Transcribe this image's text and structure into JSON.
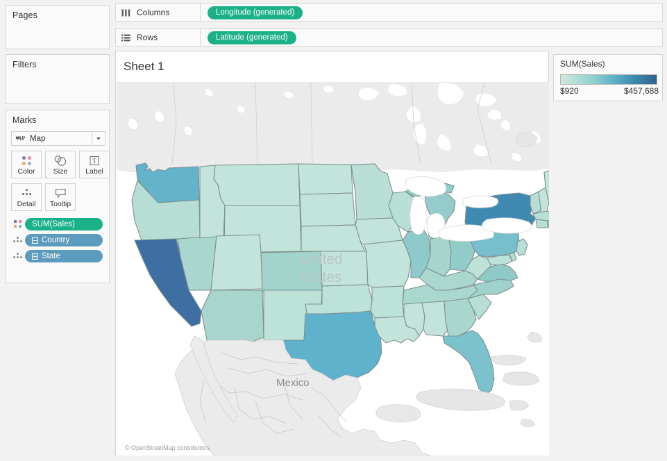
{
  "sidebar": {
    "pages": {
      "title": "Pages"
    },
    "filters": {
      "title": "Filters"
    },
    "marks": {
      "title": "Marks",
      "mark_type": "Map",
      "buttons": [
        {
          "label": "Color",
          "icon": "color-dots-icon"
        },
        {
          "label": "Size",
          "icon": "size-circles-icon"
        },
        {
          "label": "Label",
          "icon": "label-text-icon"
        },
        {
          "label": "Detail",
          "icon": "detail-dots-icon"
        },
        {
          "label": "Tooltip",
          "icon": "tooltip-bubble-icon"
        }
      ],
      "pills": [
        {
          "label": "SUM(Sales)",
          "type": "measure",
          "color": "#1ab188",
          "lead_icon": "color-dots-icon",
          "box": "none"
        },
        {
          "label": "Country",
          "type": "dimension",
          "color": "#5b9bbd",
          "lead_icon": "detail-dots-icon",
          "box": "minus"
        },
        {
          "label": "State",
          "type": "dimension",
          "color": "#5b9bbd",
          "lead_icon": "detail-dots-icon",
          "box": "plus"
        }
      ]
    }
  },
  "shelves": [
    {
      "name": "Columns",
      "icon": "columns-icon",
      "pill": "Longitude (generated)",
      "pill_color": "#1ab188"
    },
    {
      "name": "Rows",
      "icon": "rows-icon",
      "pill": "Latitude (generated)",
      "pill_color": "#1ab188"
    }
  ],
  "view": {
    "sheet_title": "Sheet 1",
    "attribution": "© OpenStreetMap contributors",
    "map_labels": {
      "united_states": "United States",
      "united_states_l1": "United",
      "united_states_l2": "States",
      "mexico": "Mexico"
    }
  },
  "legend": {
    "title": "SUM(Sales)",
    "min": "$920",
    "max": "$457,688",
    "gradient_start": "#cfeae0",
    "gradient_mid": "#5aaec8",
    "gradient_end": "#2e6490"
  },
  "chart_data": {
    "type": "map",
    "title": "Sheet 1",
    "measure": "SUM(Sales)",
    "value_min": 920,
    "value_max": 457688,
    "value_min_label": "$920",
    "value_max_label": "$457,688",
    "color_scale": [
      "#cfeae0",
      "#b3e0d8",
      "#8ed0d0",
      "#5aaec8",
      "#3b86ac",
      "#2e6490"
    ],
    "geography": "United States (states)",
    "states": [
      {
        "name": "California",
        "code": "CA",
        "bin": "very-high",
        "fill": "#3d6fa3"
      },
      {
        "name": "New York",
        "code": "NY",
        "bin": "very-high",
        "fill": "#3f8ab1"
      },
      {
        "name": "Texas",
        "code": "TX",
        "bin": "high",
        "fill": "#5eb2cb"
      },
      {
        "name": "Washington",
        "code": "WA",
        "bin": "high",
        "fill": "#63b3cb"
      },
      {
        "name": "Pennsylvania",
        "code": "PA",
        "bin": "med-high",
        "fill": "#77bfcd"
      },
      {
        "name": "Florida",
        "code": "FL",
        "bin": "med-high",
        "fill": "#7cc2cd"
      },
      {
        "name": "Illinois",
        "code": "IL",
        "bin": "med",
        "fill": "#8ecac9"
      },
      {
        "name": "Ohio",
        "code": "OH",
        "bin": "med",
        "fill": "#92ccc9"
      },
      {
        "name": "Michigan",
        "code": "MI",
        "bin": "med",
        "fill": "#93ccca"
      },
      {
        "name": "Virginia",
        "code": "VA",
        "bin": "med",
        "fill": "#8fcac9"
      },
      {
        "name": "North Carolina",
        "code": "NC",
        "bin": "med",
        "fill": "#9fd2cb"
      },
      {
        "name": "Arizona",
        "code": "AZ",
        "bin": "med-low",
        "fill": "#a8d6cd"
      },
      {
        "name": "Colorado",
        "code": "CO",
        "bin": "med-low",
        "fill": "#a3d4cc"
      },
      {
        "name": "Georgia",
        "code": "GA",
        "bin": "med-low",
        "fill": "#a9d7cd"
      },
      {
        "name": "Tennessee",
        "code": "TN",
        "bin": "med-low",
        "fill": "#aad8ce"
      },
      {
        "name": "Indiana",
        "code": "IN",
        "bin": "med-low",
        "fill": "#a5d5cd"
      },
      {
        "name": "Wisconsin",
        "code": "WI",
        "bin": "low",
        "fill": "#b7dfd5"
      },
      {
        "name": "Minnesota",
        "code": "MN",
        "bin": "low",
        "fill": "#badfd6"
      },
      {
        "name": "Oregon",
        "code": "OR",
        "bin": "low",
        "fill": "#b6ded4"
      },
      {
        "name": "Other states",
        "code": "--",
        "bin": "lowest",
        "fill": "#c2e4da"
      }
    ]
  }
}
